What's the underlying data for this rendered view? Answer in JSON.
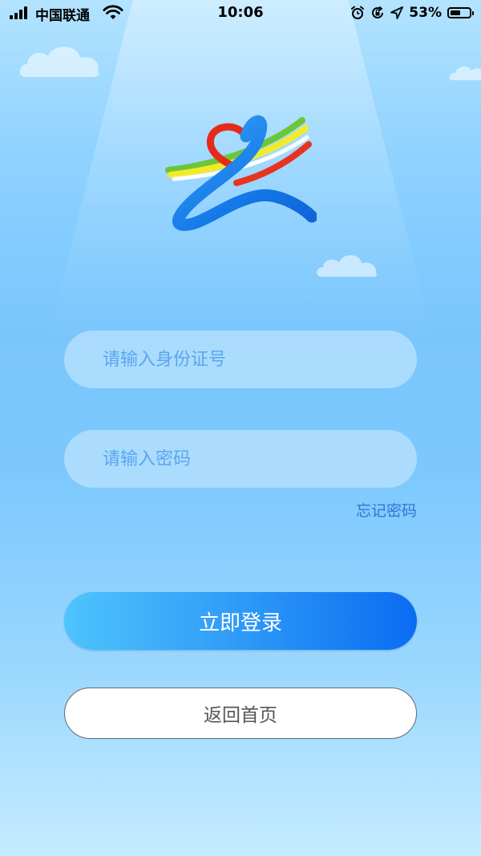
{
  "status_bar": {
    "carrier": "中国联通",
    "time": "10:06",
    "battery_percent": "53%",
    "battery_level": 0.53,
    "icons": [
      "signal-icon",
      "wifi-icon",
      "alarm-icon",
      "orientation-lock-icon",
      "location-arrow-icon",
      "battery-icon"
    ]
  },
  "logo": {
    "icon": "heart-ribbon-logo"
  },
  "form": {
    "id_number_placeholder": "请输入身份证号",
    "id_number_value": "",
    "password_placeholder": "请输入密码",
    "password_value": "",
    "forgot_password_label": "忘记密码",
    "login_label": "立即登录",
    "home_label": "返回首页"
  },
  "colors": {
    "primary_gradient_start": "#4fc4fc",
    "primary_gradient_end": "#0a6cf2",
    "link": "#2a78d6",
    "placeholder": "#5aa6ee",
    "background_top": "#b3e3ff",
    "background_bottom": "#c4ecff"
  }
}
